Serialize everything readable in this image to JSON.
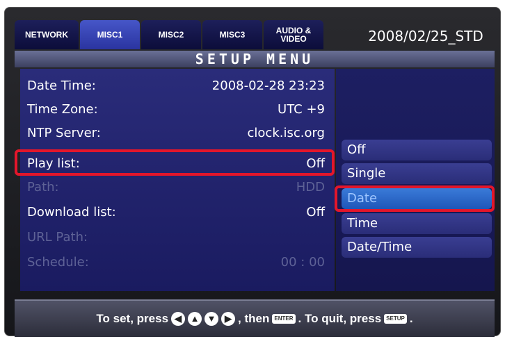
{
  "header": {
    "tabs": [
      {
        "label": "NETWORK"
      },
      {
        "label": "MISC1"
      },
      {
        "label": "MISC2"
      },
      {
        "label": "MISC3"
      },
      {
        "label": "AUDIO & VIDEO"
      }
    ],
    "active_tab": "MISC1",
    "firmware": "2008/02/25_STD",
    "menu_title": "SETUP MENU"
  },
  "settings": [
    {
      "label": "Date Time:",
      "value": "2008-02-28 23:23",
      "enabled": true
    },
    {
      "label": "Time Zone:",
      "value": "UTC +9",
      "enabled": true
    },
    {
      "label": "NTP Server:",
      "value": "clock.isc.org",
      "enabled": true
    },
    {
      "label": "Play list:",
      "value": "Off",
      "enabled": true,
      "highlighted": true
    },
    {
      "label": "Path:",
      "value": "HDD",
      "enabled": false
    },
    {
      "label": "Download list:",
      "value": "Off",
      "enabled": true
    },
    {
      "label": "URL Path:",
      "value": "",
      "enabled": false
    },
    {
      "label": "Schedule:",
      "value": "00 : 00",
      "enabled": false
    }
  ],
  "options": [
    {
      "label": "Off"
    },
    {
      "label": "Single"
    },
    {
      "label": "Date",
      "selected": true
    },
    {
      "label": "Time"
    },
    {
      "label": "Date/Time"
    }
  ],
  "footer": {
    "prefix": "To set, press",
    "then": ", then",
    "enter_key": "ENTER",
    "middle": ". To quit, press",
    "setup_key": "SETUP",
    "end": "."
  },
  "colors": {
    "highlight_border": "#e3162b",
    "selected_option": "#1f56b8",
    "panel": "#1a1b60"
  }
}
